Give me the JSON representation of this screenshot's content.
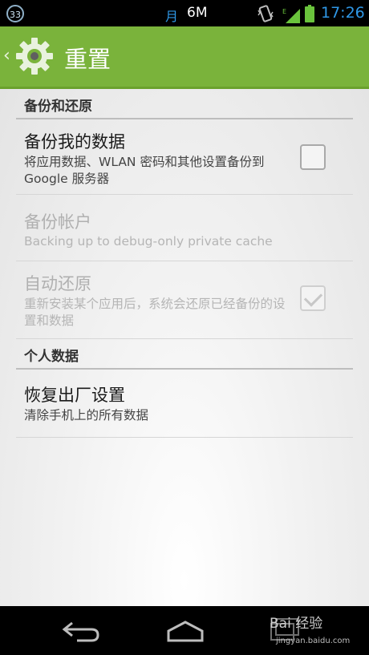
{
  "status_bar": {
    "notification_count": "33",
    "carrier_glyph": "月",
    "data_label": "6M",
    "signal_label": "E",
    "time": "17:26"
  },
  "header": {
    "title": "重置",
    "icon": "gear-icon"
  },
  "sections": [
    {
      "header": "备份和还原"
    },
    {
      "header": "个人数据"
    }
  ],
  "prefs": {
    "backup_data": {
      "title": "备份我的数据",
      "summary": "将应用数据、WLAN 密码和其他设置备份到 Google 服务器",
      "checked": false,
      "enabled": true
    },
    "backup_account": {
      "title": "备份帐户",
      "summary": "Backing up to debug-only private cache",
      "enabled": false
    },
    "auto_restore": {
      "title": "自动还原",
      "summary": "重新安装某个应用后，系统会还原已经备份的设置和数据",
      "checked": true,
      "enabled": false
    },
    "factory_reset": {
      "title": "恢复出厂设置",
      "summary": "清除手机上的所有数据",
      "enabled": true
    }
  },
  "watermark": {
    "brand": "Bai 经验",
    "url": "jingyan.baidu.com"
  },
  "colors": {
    "accent": "#7ab33b",
    "status_blue": "#2f97e6"
  }
}
